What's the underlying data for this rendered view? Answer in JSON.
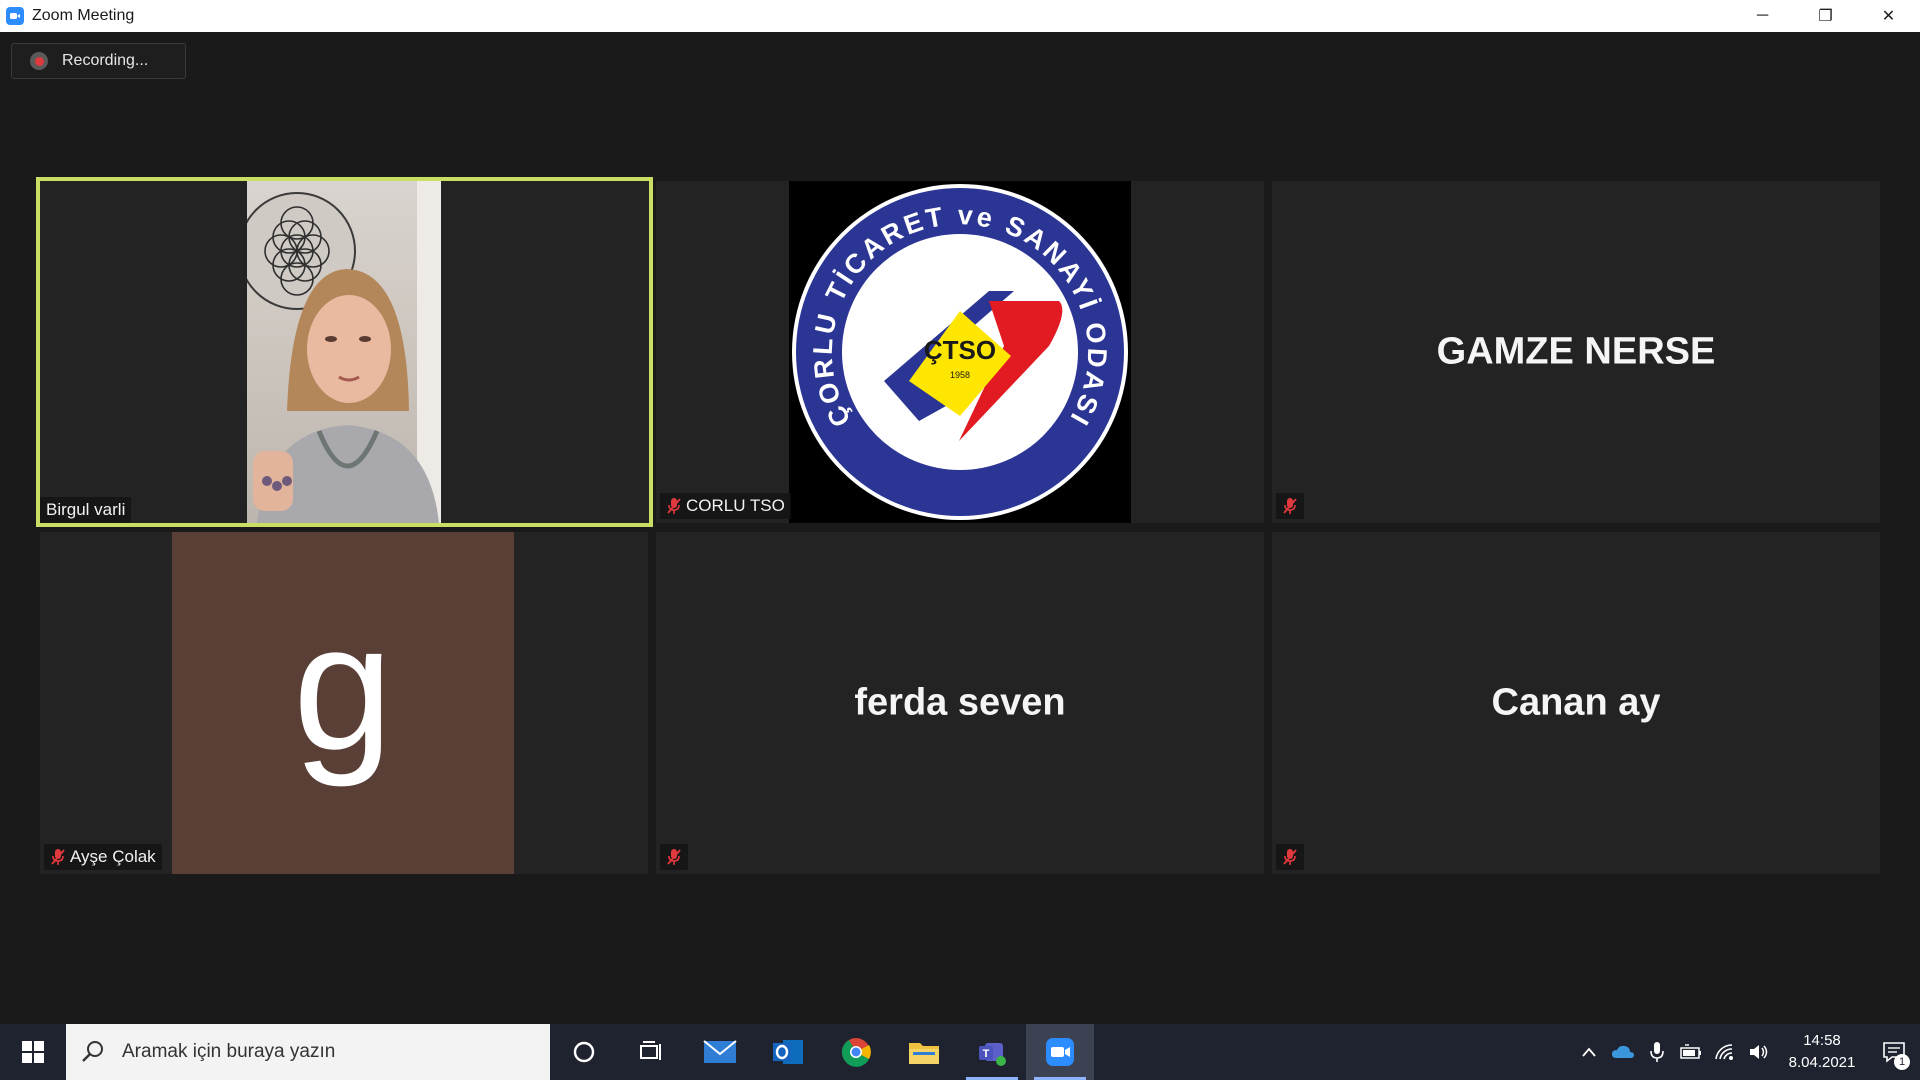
{
  "window": {
    "title": "Zoom Meeting",
    "controls": {
      "minimize": "─",
      "restore": "❐",
      "close": "✕"
    }
  },
  "recording": {
    "label": "Recording..."
  },
  "participants": [
    {
      "name": "Birgul varli",
      "muted": false,
      "video": "camera",
      "speaking": true
    },
    {
      "name": "CORLU TSO",
      "muted": true,
      "video": "logo"
    },
    {
      "name": "",
      "display_name": "GAMZE NERSE",
      "muted": true,
      "video": "off"
    },
    {
      "name": "Ayşe Çolak",
      "muted": true,
      "video": "avatar",
      "avatar_letter": "g",
      "avatar_color": "#5a3f37"
    },
    {
      "name": "",
      "display_name": "ferda seven",
      "muted": true,
      "video": "off"
    },
    {
      "name": "",
      "display_name": "Canan ay",
      "muted": true,
      "video": "off"
    }
  ],
  "logo": {
    "arc_text": "ÇORLU TİCARET ve SANAYİ ODASI",
    "center_text": "ÇTSO",
    "year": "1958",
    "colors": {
      "ring": "#2b3594",
      "red": "#e21b23",
      "yellow": "#ffe600"
    }
  },
  "taskbar": {
    "search_placeholder": "Aramak için buraya yazın",
    "apps": [
      "cortana-icon",
      "task-view-icon",
      "mail-icon",
      "outlook-icon",
      "chrome-icon",
      "file-explorer-icon",
      "teams-icon",
      "zoom-icon"
    ],
    "clock": {
      "time": "14:58",
      "date": "8.04.2021"
    },
    "notification_count": "1"
  },
  "colors": {
    "active_speaker_border": "#c9df63",
    "muted_icon": "#e0393e",
    "background": "#1a1a1a",
    "tile": "#232323"
  }
}
